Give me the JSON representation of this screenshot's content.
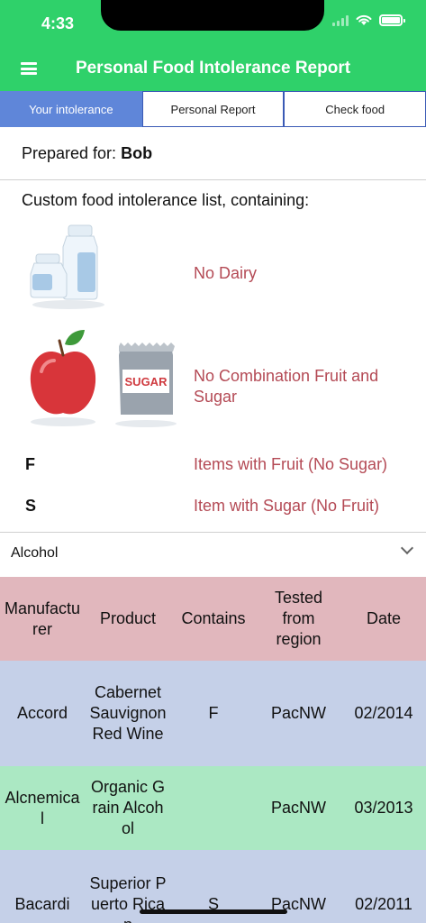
{
  "status_bar": {
    "time": "4:33"
  },
  "header": {
    "title": "Personal Food Intolerance Report",
    "menu_icon": "hamburger-icon"
  },
  "tabs": [
    {
      "label": "Your intolerance",
      "active": true
    },
    {
      "label": "Personal Report",
      "active": false
    },
    {
      "label": "Check food",
      "active": false
    }
  ],
  "prepared": {
    "label": "Prepared for:",
    "name": "Bob"
  },
  "custom_list": {
    "title": "Custom food intolerance list, containing:",
    "items": [
      {
        "icon": "dairy-bottles-icon",
        "text": "No Dairy"
      },
      {
        "icon": "apple-sugar-icon",
        "text": "No Combination Fruit and Sugar"
      },
      {
        "letter": "F",
        "text": "Items with Fruit (No Sugar)"
      },
      {
        "letter": "S",
        "text": "Item with Sugar (No Fruit)"
      }
    ]
  },
  "sugar_label": "SUGAR",
  "category": {
    "selected": "Alcohol"
  },
  "table": {
    "headers": [
      "Manufacturer",
      "Product",
      "Contains",
      "Tested from region",
      "Date"
    ],
    "rows": [
      [
        "Accord",
        "Cabernet Sauvignon Red Wine",
        "F",
        "PacNW",
        "02/2014"
      ],
      [
        "Alcnemical",
        "Organic Grain Alcohol",
        "",
        "PacNW",
        "03/2013"
      ],
      [
        "Bacardi",
        "Superior Puerto Rican",
        "S",
        "PacNW",
        "02/2011"
      ]
    ]
  },
  "colors": {
    "header_green": "#2fd16a",
    "tab_active": "#5f86d9",
    "legend_text": "#b44a55",
    "table_header": "#e1b7bd",
    "row_blue": "#c5d0e8",
    "row_green": "#abe8c3"
  }
}
